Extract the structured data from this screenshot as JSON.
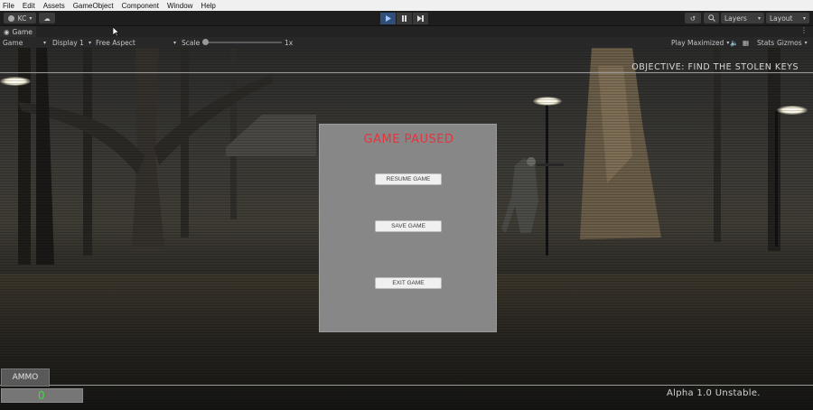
{
  "menu": [
    "File",
    "Edit",
    "Assets",
    "GameObject",
    "Component",
    "Window",
    "Help"
  ],
  "toolbar": {
    "account_label": "KC",
    "layers_label": "Layers",
    "layout_label": "Layout"
  },
  "tab": {
    "label": "Game"
  },
  "gamebar": {
    "mode": "Game",
    "display": "Display 1",
    "aspect": "Free Aspect",
    "scale_label": "Scale",
    "scale_value": "1x",
    "play_mode": "Play Maximized",
    "stats": "Stats",
    "gizmos": "Gizmos"
  },
  "hud": {
    "objective": "OBJECTIVE: FIND THE STOLEN KEYS",
    "ammo_label": "AMMO",
    "ammo_count": "0",
    "version": "Alpha 1.0 Unstable."
  },
  "pause_menu": {
    "title": "GAME PAUSED",
    "resume": "RESUME GAME",
    "save": "SAVE GAME",
    "exit": "EXIT GAME"
  },
  "colors": {
    "pause_title": "#e03640",
    "ammo_count": "#3fdc3f",
    "play_active": "#2f4f7a"
  }
}
